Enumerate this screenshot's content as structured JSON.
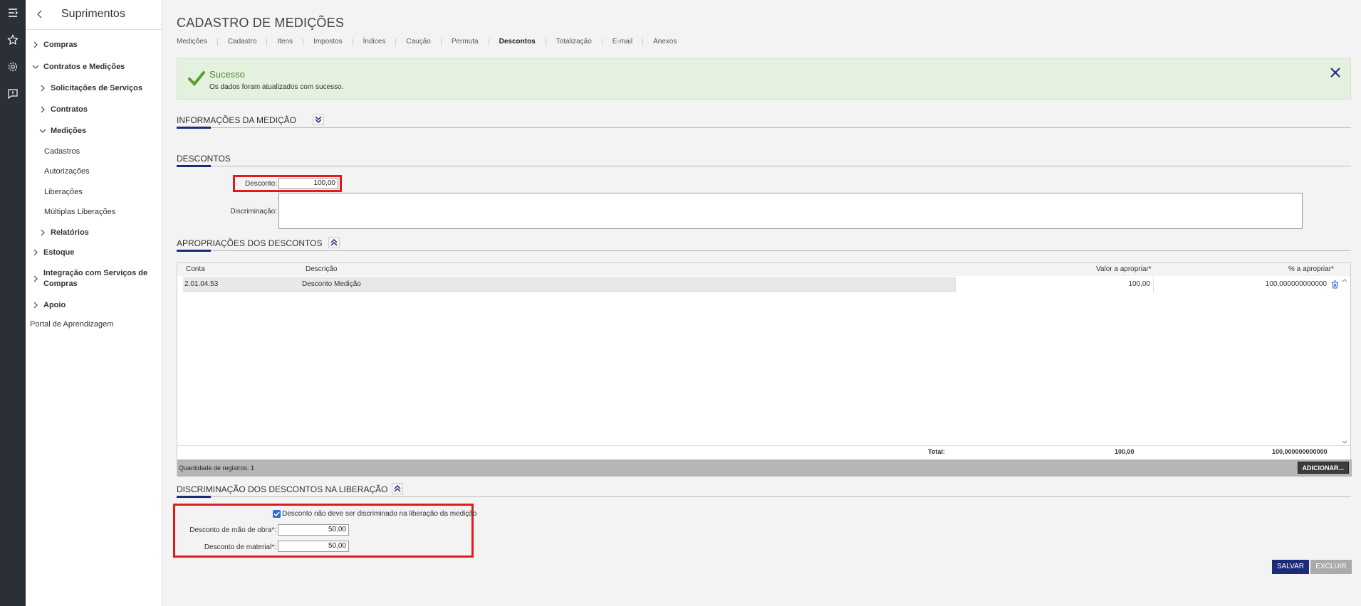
{
  "sidebar": {
    "title": "Suprimentos",
    "items": [
      {
        "label": "Compras"
      },
      {
        "label": "Contratos e Medições"
      },
      {
        "label": "Solicitações de Serviços"
      },
      {
        "label": "Contratos"
      },
      {
        "label": "Medições"
      },
      {
        "label": "Cadastros"
      },
      {
        "label": "Autorizações"
      },
      {
        "label": "Liberações"
      },
      {
        "label": "Múltiplas Liberações"
      },
      {
        "label": "Relatórios"
      },
      {
        "label": "Estoque"
      },
      {
        "label": "Integração com Serviços de"
      },
      {
        "label": "Compras"
      },
      {
        "label": "Apoio"
      },
      {
        "label": "Portal de Aprendizagem"
      }
    ]
  },
  "header": {
    "title": "CADASTRO DE MEDIÇÕES",
    "tabs": [
      "Medições",
      "Cadastro",
      "Itens",
      "Impostos",
      "Índices",
      "Caução",
      "Permuta",
      "Descontos",
      "Totalização",
      "E-mail",
      "Anexos"
    ]
  },
  "alert": {
    "title": "Sucesso",
    "message": "Os dados foram atualizados com sucesso."
  },
  "sections": {
    "info": "INFORMAÇÕES DA MEDIÇÃO",
    "descontos": "DESCONTOS",
    "apropriacoes": "APROPRIAÇÕES DOS DESCONTOS",
    "discriminacao": "DISCRIMINAÇÃO DOS DESCONTOS NA LIBERAÇÃO"
  },
  "form": {
    "desconto_label": "Desconto:",
    "desconto_value": "100,00",
    "discriminacao_label": "Discriminação:",
    "checkbox_label": "Desconto não deve ser discriminado na liberação da medição",
    "mao_obra_label": "Desconto de mão de obra*:",
    "mao_obra_value": "50,00",
    "material_label": "Desconto de material*:",
    "material_value": "50,00"
  },
  "grid": {
    "headers": {
      "conta": "Conta",
      "descricao": "Descrição",
      "valor": "Valor a apropriar*",
      "percent": "% a apropriar*"
    },
    "row": {
      "conta": "2.01.04.53",
      "descricao": "Desconto Medição",
      "valor": "100,00",
      "percent": "100,000000000000"
    },
    "footer": {
      "label": "Total:",
      "valor": "100,00",
      "percent": "100,000000000000"
    },
    "count": "Quantidade de registros: 1",
    "add_label": "ADICIONAR..."
  },
  "buttons": {
    "save": "SALVAR",
    "delete": "EXCLUIR"
  },
  "colors": {
    "accent": "#1c2a7a",
    "highlight": "#e01b1b",
    "success_bg": "#e4f1df"
  }
}
